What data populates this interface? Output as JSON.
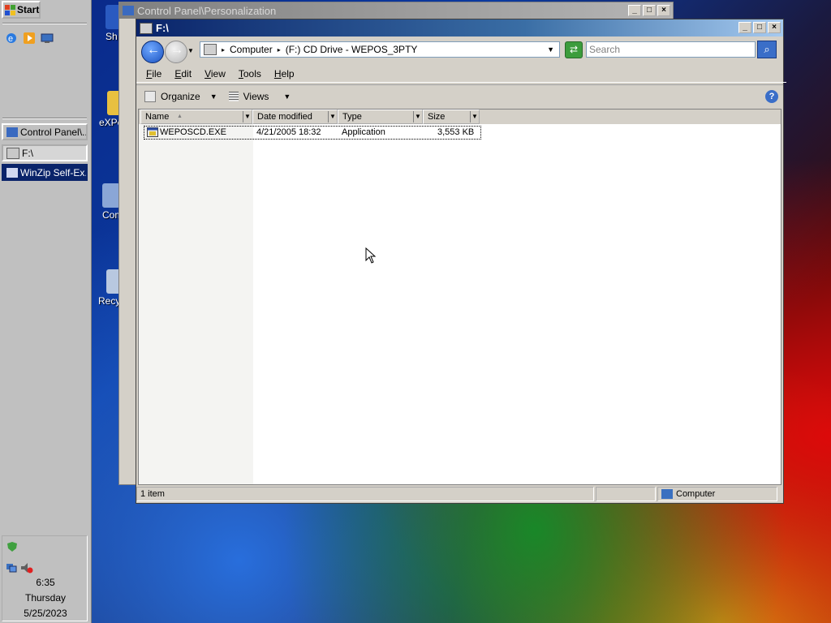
{
  "taskbar": {
    "start_label": "Start",
    "buttons": [
      {
        "label": "Control Panel\\..."
      },
      {
        "label": "F:\\"
      },
      {
        "label": "WinZip Self-Ex..."
      }
    ],
    "clock": {
      "time": "6:35",
      "day": "Thursday",
      "date": "5/25/2023"
    }
  },
  "desktop": {
    "icons": [
      {
        "label": "Sh De"
      },
      {
        "label": "eXPe"
      },
      {
        "label": "Com"
      },
      {
        "label": "Recy"
      }
    ]
  },
  "back_window": {
    "title": "Control Panel\\Personalization"
  },
  "explorer": {
    "title": "F:\\",
    "address": {
      "crumb1": "Computer",
      "crumb2": "(F:) CD Drive - WEPOS_3PTY"
    },
    "search_placeholder": "Search",
    "menu": [
      {
        "key": "F",
        "rest": "ile"
      },
      {
        "key": "E",
        "rest": "dit"
      },
      {
        "key": "V",
        "rest": "iew"
      },
      {
        "key": "T",
        "rest": "ools"
      },
      {
        "key": "H",
        "rest": "elp"
      }
    ],
    "toolbar": {
      "organize": "Organize",
      "views": "Views"
    },
    "columns": [
      "Name",
      "Date modified",
      "Type",
      "Size"
    ],
    "files": [
      {
        "name": "WEPOSCD.EXE",
        "date": "4/21/2005 18:32",
        "type": "Application",
        "size": "3,553 KB"
      }
    ],
    "status": {
      "items": "1 item",
      "location": "Computer"
    }
  },
  "colors": {
    "title_active": "#0a246a",
    "selection": "#0a246a",
    "face": "#d4d0c8"
  }
}
